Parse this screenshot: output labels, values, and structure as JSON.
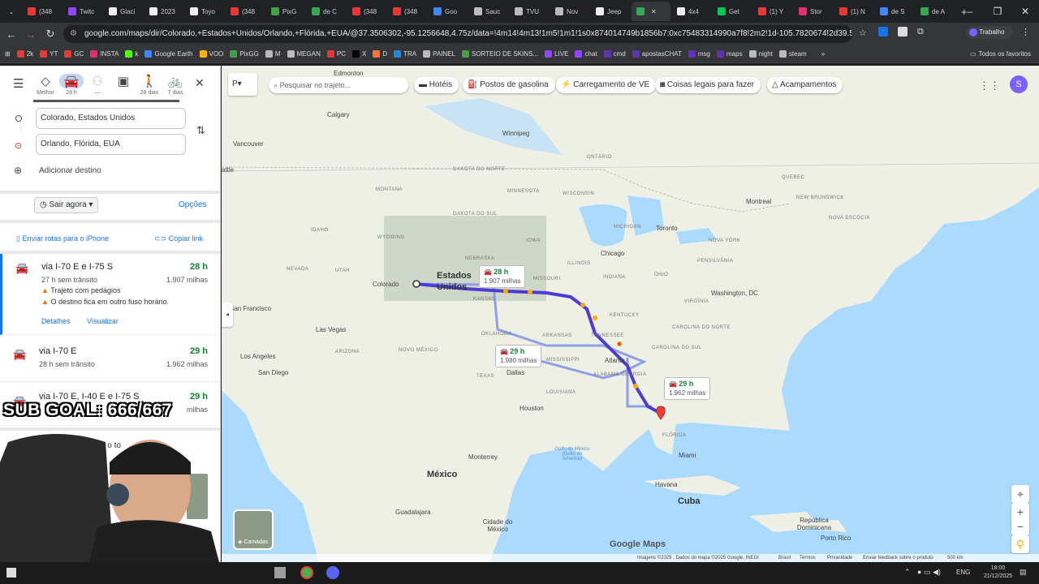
{
  "tabs": [
    {
      "label": "(348",
      "color": "#e53935"
    },
    {
      "label": "Twitc",
      "color": "#9146ff"
    },
    {
      "label": "Glaci",
      "color": "#eeeeee"
    },
    {
      "label": "2023",
      "color": "#eeeeee"
    },
    {
      "label": "Toyo",
      "color": "#eeeeee"
    },
    {
      "label": "(348",
      "color": "#e53935"
    },
    {
      "label": "PixG",
      "color": "#43a047"
    },
    {
      "label": "de C",
      "color": "#34a853"
    },
    {
      "label": "(348",
      "color": "#e53935"
    },
    {
      "label": "(348",
      "color": "#e53935"
    },
    {
      "label": "Goo",
      "color": "#4285f4"
    },
    {
      "label": "Sauc",
      "color": "#bbbbbb"
    },
    {
      "label": "TVU",
      "color": "#bbbbbb"
    },
    {
      "label": "Nov",
      "color": "#bbbbbb"
    },
    {
      "label": "Jeep",
      "color": "#eeeeee"
    },
    {
      "label": "",
      "color": "#34a853",
      "active": true
    },
    {
      "label": "4x4",
      "color": "#eeeeee"
    },
    {
      "label": "Get",
      "color": "#00c853"
    },
    {
      "label": "(1) Y",
      "color": "#e53935"
    },
    {
      "label": "Stor",
      "color": "#e1306c"
    },
    {
      "label": "(1) N",
      "color": "#e53935"
    },
    {
      "label": "de S",
      "color": "#4285f4"
    },
    {
      "label": "de A",
      "color": "#34a853"
    }
  ],
  "address": {
    "url": "google.com/maps/dir/Colorado,+Estados+Unidos/Orlando,+Flórida,+EUA/@37.3506302,-95.1256648,4.75z/data=!4m14!4m13!1m5!1m1!1s0x874014749b1856b7:0xc75483314990a7f8!2m2!1d-105.7820674!2d39.5500507!1..."
  },
  "bookmarks": [
    {
      "label": "2k",
      "color": "#e53935"
    },
    {
      "label": "YT",
      "color": "#e53935"
    },
    {
      "label": "GC",
      "color": "#e53935"
    },
    {
      "label": "INSTA",
      "color": "#e1306c"
    },
    {
      "label": "k",
      "color": "#53fc18"
    },
    {
      "label": "Google Earth",
      "color": "#4285f4"
    },
    {
      "label": "VOO",
      "color": "#ffb300"
    },
    {
      "label": "PixGG",
      "color": "#43a047"
    },
    {
      "label": "M",
      "color": "#bbbbbb"
    },
    {
      "label": "MEGAN",
      "color": "#bbbbbb"
    },
    {
      "label": "PC",
      "color": "#e53935"
    },
    {
      "label": "X",
      "color": "#000000"
    },
    {
      "label": "D",
      "color": "#ff7043"
    },
    {
      "label": "TRA",
      "color": "#1e88e5"
    },
    {
      "label": "PAINEL",
      "color": "#bbbbbb"
    },
    {
      "label": "SORTEIO DE SKINS...",
      "color": "#43a047"
    },
    {
      "label": "LIVE",
      "color": "#9146ff"
    },
    {
      "label": "chat",
      "color": "#9146ff"
    },
    {
      "label": "cmd",
      "color": "#5e35b1"
    },
    {
      "label": "apostasCHAT",
      "color": "#5e35b1"
    },
    {
      "label": "msg",
      "color": "#5e35b1"
    },
    {
      "label": "maps",
      "color": "#5e35b1"
    },
    {
      "label": "night",
      "color": "#bbbbbb"
    },
    {
      "label": "steam",
      "color": "#bbbbbb"
    }
  ],
  "bookmarks_other": "Todos os favoritos",
  "sidebar": {
    "modes": [
      {
        "label": "Melhor"
      },
      {
        "label": "28 h",
        "selected": true
      },
      {
        "label": "—"
      },
      {
        "label": ""
      },
      {
        "label": "28 dias"
      },
      {
        "label": "7 dias"
      }
    ],
    "origin": "Colorado, Estados Unidos",
    "destination": "Orlando, Flórida, EUA",
    "add_destination": "Adicionar destino",
    "depart": "Sair agora",
    "options": "Opções",
    "send_to_phone": "Enviar rotas para o iPhone",
    "copy_link": "Copiar link",
    "routes": [
      {
        "name": "via I-70 E e I-75 S",
        "time": "28 h",
        "sub": "27 h sem trânsito",
        "distance": "1.907 milhas",
        "warn1": "Trajeto com pedágios",
        "warn2": "O destino fica em outro fuso horário.",
        "details": "Detalhes",
        "preview": "Visualizar"
      },
      {
        "name": "via I-70 E",
        "time": "29 h",
        "sub": "28 h sem trânsito",
        "distance": "1.962 milhas"
      },
      {
        "name": "via I-70 E, I-40 E e I-75 S",
        "time": "29 h",
        "sub": "",
        "distance": "milhas"
      }
    ],
    "bottom_text": "ares o    to"
  },
  "map": {
    "search_placeholder": "Pesquisar no trajeto...",
    "chips": [
      "Hotéis",
      "Postos de gasolina",
      "Carregamento de VE",
      "Coisas legais para fazer",
      "Acampamentos"
    ],
    "layers": "Camadas",
    "callouts": [
      {
        "time": "28 h",
        "dist": "1.907 milhas"
      },
      {
        "time": "29 h",
        "dist": "1.980 milhas"
      },
      {
        "time": "29 h",
        "dist": "1.962 milhas"
      }
    ],
    "country_labels": {
      "us": "Estados Unidos",
      "mx": "México",
      "cu": "Cuba"
    },
    "cities": {
      "calgary": "Calgary",
      "edmonton": "Edmonton",
      "vancouver": "Vancouver",
      "winnipeg": "Winnipeg",
      "seattle": "attle",
      "sf": "San Francisco",
      "lv": "Las Vegas",
      "la": "Los Angeles",
      "sd": "San Diego",
      "colorado": "Colorado",
      "chicago": "Chicago",
      "toronto": "Toronto",
      "montreal": "Montreal",
      "washington": "Washington, DC",
      "atlanta": "Atlanta",
      "dallas": "Dallas",
      "houston": "Houston",
      "monterrey": "Monterrey",
      "guadalajara": "Guadalajara",
      "cdmx": "Cidade do México",
      "miami": "Miami",
      "havana": "Havana",
      "rd": "República Dominicana",
      "pr": "Porto Rico",
      "gulf": "Golfo do México (Golfo de América)"
    },
    "states": {
      "wyoming": "WYOMING",
      "sd": "DAKOTA DO SUL",
      "nd": "DAKOTA DO NORTE",
      "minnesota": "MINNESOTA",
      "wisconsin": "WISCONSIN",
      "michigan": "MICHIGAN",
      "iowa": "IOWA",
      "illinois": "ILLINOIS",
      "missouri": "MISSOURI",
      "kansas": "KANSAS",
      "oklahoma": "OKLAHOMA",
      "texas": "TEXAS",
      "nm": "NOVO MÉXICO",
      "arizona": "ARIZONA",
      "nevada": "NEVADA",
      "utah": "UTAH",
      "kentucky": "KENTUCKY",
      "tennessee": "TENNESSEE",
      "alabama": "ALABAMA",
      "georgia": "GEORGIA",
      "florida": "FLÓRIDA",
      "mississippi": "MISSISSIPPI",
      "ontario": "ONTÁRIO",
      "quebec": "QUEBEC",
      "ns": "NOVA ESCÓCIA",
      "nb": "NEW BRUNSWICK",
      "ohio": "OHIO",
      "pa": "PENSILVÂNIA",
      "ny": "NOVA YORK",
      "va": "VIRGÍNIA",
      "nc": "CAROLINA DO NORTE",
      "sc": "CAROLINA DO SUL",
      "louisiana": "LOUISIANA",
      "arkansas": "ARKANSAS",
      "indiana": "INDIANA",
      "nebraska": "NEBRASKA",
      "montana": "MONTANA",
      "idaho": "IDAHO"
    },
    "footer": {
      "attrib": "Imagens ©2025 , Dados do mapa ©2025 Google, INEGI",
      "brasil": "Brasil",
      "terms": "Termos",
      "privacy": "Privacidade",
      "feedback": "Enviar feedback sobre o produto",
      "scale": "500 km"
    },
    "logo": "Google Maps"
  },
  "overlay": {
    "text": "SUB GOAL: 666/667"
  },
  "taskbar": {
    "lang": "ENG",
    "time": "18:00",
    "date": "21/12/2025"
  },
  "colors": {
    "route_primary": "#4d3bd6",
    "route_alt": "#8f9fe6",
    "land": "#eef0e6",
    "water": "#aadaff",
    "accent_green": "#188038",
    "accent_blue": "#1a73e8"
  }
}
